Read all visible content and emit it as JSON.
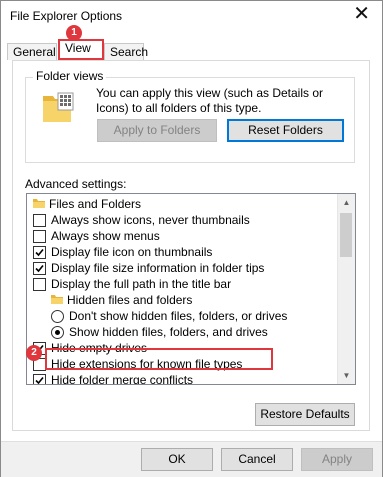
{
  "window": {
    "title": "File Explorer Options",
    "close_glyph": "✕"
  },
  "tabs": [
    {
      "label": "General"
    },
    {
      "label": "View"
    },
    {
      "label": "Search"
    }
  ],
  "badges": {
    "step1": "1",
    "step2": "2",
    "color": "#e0363d"
  },
  "folder_views": {
    "legend": "Folder views",
    "description": "You can apply this view (such as Details or Icons) to all folders of this type.",
    "apply_label": "Apply to Folders",
    "reset_label": "Reset Folders"
  },
  "advanced": {
    "label": "Advanced settings:",
    "items": [
      {
        "kind": "folder",
        "label": "Files and Folders"
      },
      {
        "kind": "checkbox",
        "checked": false,
        "label": "Always show icons, never thumbnails"
      },
      {
        "kind": "checkbox",
        "checked": false,
        "label": "Always show menus"
      },
      {
        "kind": "checkbox",
        "checked": true,
        "label": "Display file icon on thumbnails"
      },
      {
        "kind": "checkbox",
        "checked": true,
        "label": "Display file size information in folder tips"
      },
      {
        "kind": "checkbox",
        "checked": false,
        "label": "Display the full path in the title bar"
      },
      {
        "kind": "folder",
        "label": "Hidden files and folders"
      },
      {
        "kind": "radio",
        "checked": false,
        "label": "Don't show hidden files, folders, or drives"
      },
      {
        "kind": "radio",
        "checked": true,
        "label": "Show hidden files, folders, and drives"
      },
      {
        "kind": "checkbox",
        "checked": true,
        "label": "Hide empty drives"
      },
      {
        "kind": "checkbox",
        "checked": false,
        "label": "Hide extensions for known file types"
      },
      {
        "kind": "checkbox",
        "checked": true,
        "label": "Hide folder merge conflicts"
      }
    ]
  },
  "restore_label": "Restore Defaults",
  "footer": {
    "ok_label": "OK",
    "cancel_label": "Cancel",
    "apply_label": "Apply"
  }
}
